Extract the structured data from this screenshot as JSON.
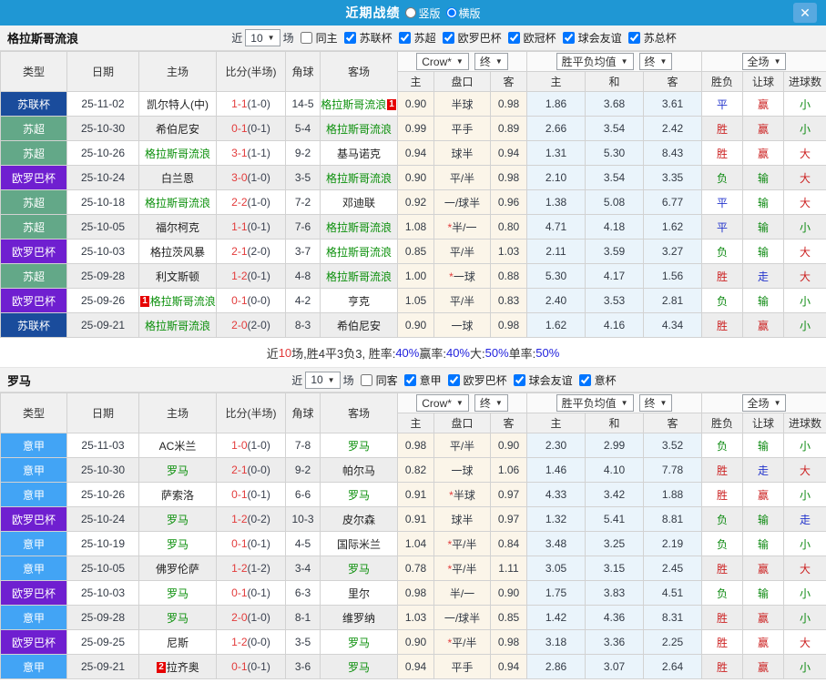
{
  "titlebar": {
    "title": "近期战绩",
    "radio_vertical": "竖版",
    "radio_horizontal": "横版",
    "close": "✕"
  },
  "table_header": {
    "cols": [
      "类型",
      "日期",
      "主场",
      "比分(半场)",
      "角球",
      "客场"
    ],
    "sub": [
      "主",
      "盘口",
      "客",
      "主",
      "和",
      "客",
      "胜负",
      "让球",
      "进球数"
    ],
    "select_company": "Crow*",
    "select_final1": "终",
    "select_avg": "胜平负均值",
    "select_final2": "终",
    "select_scope": "全场",
    "arrow": "▼"
  },
  "league_colors": {
    "苏联杯": "#1A4C9C",
    "苏超": "#63A888",
    "欧罗巴杯": "#6F1FD0",
    "意甲": "#42A4F5"
  },
  "outcome_colors": {
    "胜": "res-red",
    "平": "res-blue",
    "负": "res-green",
    "赢": "res-red",
    "走": "res-blue",
    "输": "res-green",
    "大": "res-red",
    "小": "res-green"
  },
  "sections": [
    {
      "team": "格拉斯哥流浪",
      "filters": {
        "near": "近",
        "rounds": "10",
        "games": "场",
        "venue": "同主",
        "venue_checked": false,
        "leagues": [
          "苏联杯",
          "苏超",
          "欧罗巴杯",
          "欧冠杯",
          "球会友谊",
          "苏总杯"
        ]
      },
      "rows": [
        {
          "league": "苏联杯",
          "date": "25-11-02",
          "home": "凯尔特人(中)",
          "home_self": false,
          "home_rank": "",
          "score": "1-1",
          "half": "1-0",
          "corner": "14-5",
          "away": "格拉斯哥流浪",
          "away_self": true,
          "away_rank": "1",
          "h_home": "0.90",
          "h_star": false,
          "handicap": "半球",
          "h_away": "0.98",
          "avg_home": "1.86",
          "avg_draw": "3.68",
          "avg_away": "3.61",
          "res": "平",
          "hres": "赢",
          "goals": "小"
        },
        {
          "league": "苏超",
          "date": "25-10-30",
          "home": "希伯尼安",
          "home_self": false,
          "home_rank": "",
          "score": "0-1",
          "half": "0-1",
          "corner": "5-4",
          "away": "格拉斯哥流浪",
          "away_self": true,
          "away_rank": "",
          "h_home": "0.99",
          "h_star": false,
          "handicap": "平手",
          "h_away": "0.89",
          "avg_home": "2.66",
          "avg_draw": "3.54",
          "avg_away": "2.42",
          "res": "胜",
          "hres": "赢",
          "goals": "小"
        },
        {
          "league": "苏超",
          "date": "25-10-26",
          "home": "格拉斯哥流浪",
          "home_self": true,
          "home_rank": "",
          "score": "3-1",
          "half": "1-1",
          "corner": "9-2",
          "away": "基马诺克",
          "away_self": false,
          "away_rank": "",
          "h_home": "0.94",
          "h_star": false,
          "handicap": "球半",
          "h_away": "0.94",
          "avg_home": "1.31",
          "avg_draw": "5.30",
          "avg_away": "8.43",
          "res": "胜",
          "hres": "赢",
          "goals": "大"
        },
        {
          "league": "欧罗巴杯",
          "date": "25-10-24",
          "home": "白兰恩",
          "home_self": false,
          "home_rank": "",
          "score": "3-0",
          "half": "1-0",
          "corner": "3-5",
          "away": "格拉斯哥流浪",
          "away_self": true,
          "away_rank": "",
          "h_home": "0.90",
          "h_star": false,
          "handicap": "平/半",
          "h_away": "0.98",
          "avg_home": "2.10",
          "avg_draw": "3.54",
          "avg_away": "3.35",
          "res": "负",
          "hres": "输",
          "goals": "大"
        },
        {
          "league": "苏超",
          "date": "25-10-18",
          "home": "格拉斯哥流浪",
          "home_self": true,
          "home_rank": "",
          "score": "2-2",
          "half": "1-0",
          "corner": "7-2",
          "away": "邓迪联",
          "away_self": false,
          "away_rank": "",
          "h_home": "0.92",
          "h_star": false,
          "handicap": "一/球半",
          "h_away": "0.96",
          "avg_home": "1.38",
          "avg_draw": "5.08",
          "avg_away": "6.77",
          "res": "平",
          "hres": "输",
          "goals": "大"
        },
        {
          "league": "苏超",
          "date": "25-10-05",
          "home": "福尔柯克",
          "home_self": false,
          "home_rank": "",
          "score": "1-1",
          "half": "0-1",
          "corner": "7-6",
          "away": "格拉斯哥流浪",
          "away_self": true,
          "away_rank": "",
          "h_home": "1.08",
          "h_star": true,
          "handicap": "半/一",
          "h_away": "0.80",
          "avg_home": "4.71",
          "avg_draw": "4.18",
          "avg_away": "1.62",
          "res": "平",
          "hres": "输",
          "goals": "小"
        },
        {
          "league": "欧罗巴杯",
          "date": "25-10-03",
          "home": "格拉茨风暴",
          "home_self": false,
          "home_rank": "",
          "score": "2-1",
          "half": "2-0",
          "corner": "3-7",
          "away": "格拉斯哥流浪",
          "away_self": true,
          "away_rank": "",
          "h_home": "0.85",
          "h_star": false,
          "handicap": "平/半",
          "h_away": "1.03",
          "avg_home": "2.11",
          "avg_draw": "3.59",
          "avg_away": "3.27",
          "res": "负",
          "hres": "输",
          "goals": "大"
        },
        {
          "league": "苏超",
          "date": "25-09-28",
          "home": "利文斯顿",
          "home_self": false,
          "home_rank": "",
          "score": "1-2",
          "half": "0-1",
          "corner": "4-8",
          "away": "格拉斯哥流浪",
          "away_self": true,
          "away_rank": "",
          "h_home": "1.00",
          "h_star": true,
          "handicap": "一球",
          "h_away": "0.88",
          "avg_home": "5.30",
          "avg_draw": "4.17",
          "avg_away": "1.56",
          "res": "胜",
          "hres": "走",
          "goals": "大"
        },
        {
          "league": "欧罗巴杯",
          "date": "25-09-26",
          "home": "格拉斯哥流浪",
          "home_self": true,
          "home_rank": "1",
          "score": "0-1",
          "half": "0-0",
          "corner": "4-2",
          "away": "亨克",
          "away_self": false,
          "away_rank": "",
          "h_home": "1.05",
          "h_star": false,
          "handicap": "平/半",
          "h_away": "0.83",
          "avg_home": "2.40",
          "avg_draw": "3.53",
          "avg_away": "2.81",
          "res": "负",
          "hres": "输",
          "goals": "小"
        },
        {
          "league": "苏联杯",
          "date": "25-09-21",
          "home": "格拉斯哥流浪",
          "home_self": true,
          "home_rank": "",
          "score": "2-0",
          "half": "2-0",
          "corner": "8-3",
          "away": "希伯尼安",
          "away_self": false,
          "away_rank": "",
          "h_home": "0.90",
          "h_star": false,
          "handicap": "一球",
          "h_away": "0.98",
          "avg_home": "1.62",
          "avg_draw": "4.16",
          "avg_away": "4.34",
          "res": "胜",
          "hres": "赢",
          "goals": "小"
        }
      ],
      "summary": [
        {
          "t": "近",
          "c": "d"
        },
        {
          "t": "10",
          "c": "r"
        },
        {
          "t": "场,胜4平3负3, 胜率:",
          "c": "d"
        },
        {
          "t": "40%",
          "c": "b"
        },
        {
          "t": " 赢率:",
          "c": "d"
        },
        {
          "t": "40%",
          "c": "b"
        },
        {
          "t": " 大:",
          "c": "d"
        },
        {
          "t": "50%",
          "c": "b"
        },
        {
          "t": " 单率:",
          "c": "d"
        },
        {
          "t": "50%",
          "c": "b"
        }
      ]
    },
    {
      "team": "罗马",
      "filters": {
        "near": "近",
        "rounds": "10",
        "games": "场",
        "venue": "同客",
        "venue_checked": false,
        "leagues": [
          "意甲",
          "欧罗巴杯",
          "球会友谊",
          "意杯"
        ]
      },
      "rows": [
        {
          "league": "意甲",
          "date": "25-11-03",
          "home": "AC米兰",
          "home_self": false,
          "home_rank": "",
          "score": "1-0",
          "half": "1-0",
          "corner": "7-8",
          "away": "罗马",
          "away_self": true,
          "away_rank": "",
          "h_home": "0.98",
          "h_star": false,
          "handicap": "平/半",
          "h_away": "0.90",
          "avg_home": "2.30",
          "avg_draw": "2.99",
          "avg_away": "3.52",
          "res": "负",
          "hres": "输",
          "goals": "小"
        },
        {
          "league": "意甲",
          "date": "25-10-30",
          "home": "罗马",
          "home_self": true,
          "home_rank": "",
          "score": "2-1",
          "half": "0-0",
          "corner": "9-2",
          "away": "帕尔马",
          "away_self": false,
          "away_rank": "",
          "h_home": "0.82",
          "h_star": false,
          "handicap": "一球",
          "h_away": "1.06",
          "avg_home": "1.46",
          "avg_draw": "4.10",
          "avg_away": "7.78",
          "res": "胜",
          "hres": "走",
          "goals": "大"
        },
        {
          "league": "意甲",
          "date": "25-10-26",
          "home": "萨索洛",
          "home_self": false,
          "home_rank": "",
          "score": "0-1",
          "half": "0-1",
          "corner": "6-6",
          "away": "罗马",
          "away_self": true,
          "away_rank": "",
          "h_home": "0.91",
          "h_star": true,
          "handicap": "半球",
          "h_away": "0.97",
          "avg_home": "4.33",
          "avg_draw": "3.42",
          "avg_away": "1.88",
          "res": "胜",
          "hres": "赢",
          "goals": "小"
        },
        {
          "league": "欧罗巴杯",
          "date": "25-10-24",
          "home": "罗马",
          "home_self": true,
          "home_rank": "",
          "score": "1-2",
          "half": "0-2",
          "corner": "10-3",
          "away": "皮尔森",
          "away_self": false,
          "away_rank": "",
          "h_home": "0.91",
          "h_star": false,
          "handicap": "球半",
          "h_away": "0.97",
          "avg_home": "1.32",
          "avg_draw": "5.41",
          "avg_away": "8.81",
          "res": "负",
          "hres": "输",
          "goals": "走"
        },
        {
          "league": "意甲",
          "date": "25-10-19",
          "home": "罗马",
          "home_self": true,
          "home_rank": "",
          "score": "0-1",
          "half": "0-1",
          "corner": "4-5",
          "away": "国际米兰",
          "away_self": false,
          "away_rank": "",
          "h_home": "1.04",
          "h_star": true,
          "handicap": "平/半",
          "h_away": "0.84",
          "avg_home": "3.48",
          "avg_draw": "3.25",
          "avg_away": "2.19",
          "res": "负",
          "hres": "输",
          "goals": "小"
        },
        {
          "league": "意甲",
          "date": "25-10-05",
          "home": "佛罗伦萨",
          "home_self": false,
          "home_rank": "",
          "score": "1-2",
          "half": "1-2",
          "corner": "3-4",
          "away": "罗马",
          "away_self": true,
          "away_rank": "",
          "h_home": "0.78",
          "h_star": true,
          "handicap": "平/半",
          "h_away": "1.11",
          "avg_home": "3.05",
          "avg_draw": "3.15",
          "avg_away": "2.45",
          "res": "胜",
          "hres": "赢",
          "goals": "大"
        },
        {
          "league": "欧罗巴杯",
          "date": "25-10-03",
          "home": "罗马",
          "home_self": true,
          "home_rank": "",
          "score": "0-1",
          "half": "0-1",
          "corner": "6-3",
          "away": "里尔",
          "away_self": false,
          "away_rank": "",
          "h_home": "0.98",
          "h_star": false,
          "handicap": "半/一",
          "h_away": "0.90",
          "avg_home": "1.75",
          "avg_draw": "3.83",
          "avg_away": "4.51",
          "res": "负",
          "hres": "输",
          "goals": "小"
        },
        {
          "league": "意甲",
          "date": "25-09-28",
          "home": "罗马",
          "home_self": true,
          "home_rank": "",
          "score": "2-0",
          "half": "1-0",
          "corner": "8-1",
          "away": "维罗纳",
          "away_self": false,
          "away_rank": "",
          "h_home": "1.03",
          "h_star": false,
          "handicap": "一/球半",
          "h_away": "0.85",
          "avg_home": "1.42",
          "avg_draw": "4.36",
          "avg_away": "8.31",
          "res": "胜",
          "hres": "赢",
          "goals": "小"
        },
        {
          "league": "欧罗巴杯",
          "date": "25-09-25",
          "home": "尼斯",
          "home_self": false,
          "home_rank": "",
          "score": "1-2",
          "half": "0-0",
          "corner": "3-5",
          "away": "罗马",
          "away_self": true,
          "away_rank": "",
          "h_home": "0.90",
          "h_star": true,
          "handicap": "平/半",
          "h_away": "0.98",
          "avg_home": "3.18",
          "avg_draw": "3.36",
          "avg_away": "2.25",
          "res": "胜",
          "hres": "赢",
          "goals": "大"
        },
        {
          "league": "意甲",
          "date": "25-09-21",
          "home": "拉齐奥",
          "home_self": false,
          "home_rank": "2",
          "score": "0-1",
          "half": "0-1",
          "corner": "3-6",
          "away": "罗马",
          "away_self": true,
          "away_rank": "",
          "h_home": "0.94",
          "h_star": false,
          "handicap": "平手",
          "h_away": "0.94",
          "avg_home": "2.86",
          "avg_draw": "3.07",
          "avg_away": "2.64",
          "res": "胜",
          "hres": "赢",
          "goals": "小"
        }
      ],
      "summary": []
    }
  ]
}
